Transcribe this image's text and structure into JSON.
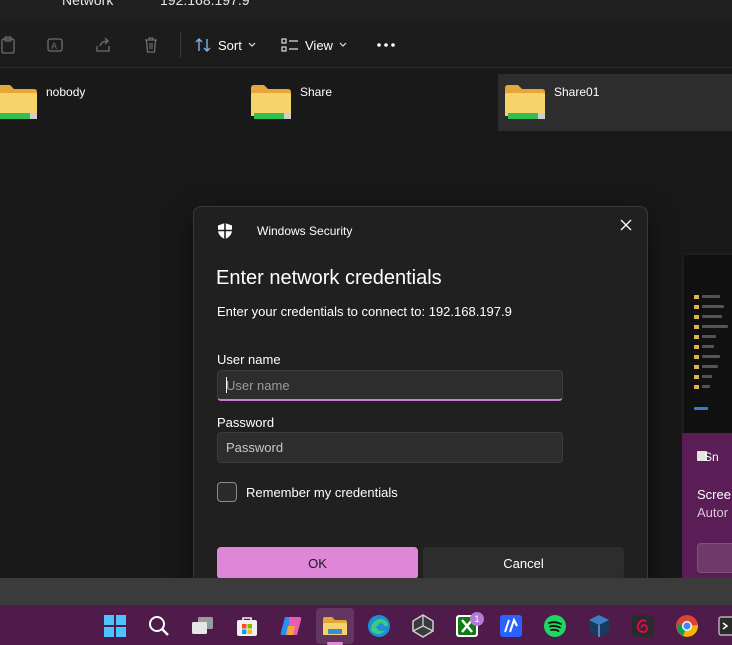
{
  "explorer": {
    "breadcrumb": [
      "Network",
      "192.168.197.9"
    ],
    "toolbar": {
      "sort_label": "Sort",
      "view_label": "View"
    },
    "folders": [
      {
        "name": "nobody",
        "selected": false
      },
      {
        "name": "Share",
        "selected": false
      },
      {
        "name": "Share01",
        "selected": true
      }
    ]
  },
  "dialog": {
    "app_title": "Windows Security",
    "heading": "Enter network credentials",
    "subtitle": "Enter your credentials to connect to: 192.168.197.9",
    "username": {
      "label": "User name",
      "placeholder": "User name",
      "value": ""
    },
    "password": {
      "label": "Password",
      "placeholder": "Password",
      "value": ""
    },
    "remember_label": "Remember my credentials",
    "remember_checked": false,
    "ok_label": "OK",
    "cancel_label": "Cancel",
    "accent_color": "#e086d8"
  },
  "preview": {
    "app_name": "Sn",
    "line1": "Scree",
    "line2": "Autor"
  },
  "taskbar": {
    "background": "#4e1b4a",
    "icons": [
      "windows-start-icon",
      "search-icon",
      "task-view-icon",
      "microsoft-store-icon",
      "copilot-icon",
      "file-explorer-icon",
      "edge-icon",
      "unity-icon",
      "xbox-icon",
      "code-icon",
      "spotify-icon",
      "virtualbox-icon",
      "debian-icon",
      "chrome-icon",
      "terminal-icon"
    ],
    "xbox_badge": "1"
  }
}
